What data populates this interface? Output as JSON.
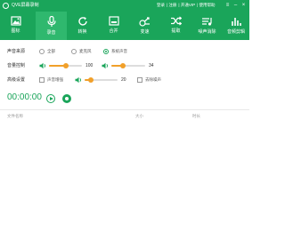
{
  "app": {
    "title": "QVE屏幕录制"
  },
  "top_links": [
    "登录",
    "注册",
    "开通VIP",
    "使用帮助"
  ],
  "window_controls": {
    "menu": "≡",
    "minimize": "–",
    "close": "×"
  },
  "nav": [
    {
      "label": "图标",
      "icon": "image-icon",
      "active": false
    },
    {
      "label": "录音",
      "icon": "microphone-icon",
      "active": true
    },
    {
      "label": "转换",
      "icon": "refresh-icon",
      "active": false
    },
    {
      "label": "合并",
      "icon": "merge-icon",
      "active": false
    },
    {
      "label": "变速",
      "icon": "speed-icon",
      "active": false
    },
    {
      "label": "提取",
      "icon": "shuffle-icon",
      "active": false
    },
    {
      "label": "噪声消除",
      "icon": "audio-wave-icon",
      "active": false
    },
    {
      "label": "音频剪辑",
      "icon": "equalizer-icon",
      "active": false
    }
  ],
  "source": {
    "label": "声音来源",
    "options": [
      "全部",
      "麦克风",
      "系统声音"
    ],
    "selected": "系统声音"
  },
  "volume": {
    "label": "音量控制",
    "system_value": "100",
    "system_level": 0.5,
    "mic_value": "34",
    "mic_level": 0.34
  },
  "advanced": {
    "label": "高级设置",
    "enhance_label": "声音增强",
    "enhance_value": "20",
    "enhance_level": 0.2,
    "denoise_label": "去除噪声"
  },
  "recorder": {
    "time": "00:00:00"
  },
  "table": {
    "col_name": "文件名称",
    "col_size": "大小",
    "col_duration": "时长"
  },
  "colors": {
    "primary": "#1aa55a",
    "accent": "#f1a02a"
  }
}
